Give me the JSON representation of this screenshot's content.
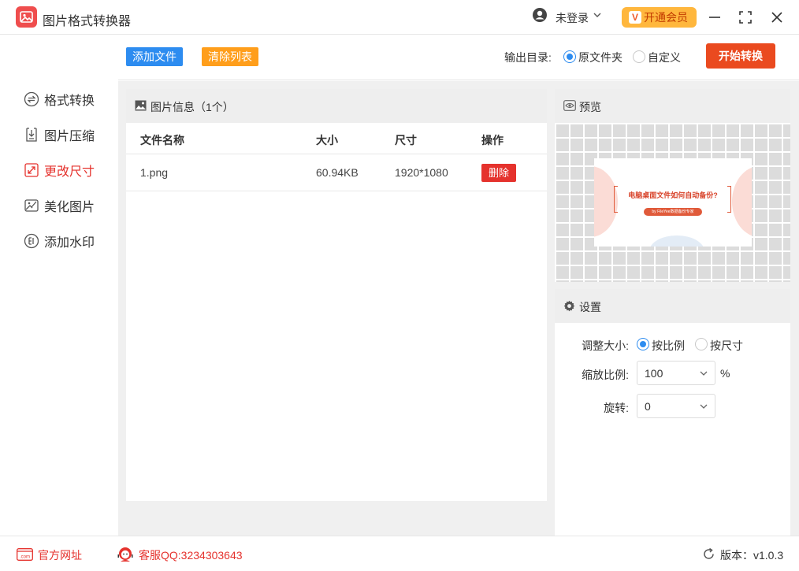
{
  "app": {
    "title": "图片格式转换器"
  },
  "user": {
    "name": "未登录",
    "vip_label": "开通会员",
    "vip_glyph": "V"
  },
  "sidebar": {
    "items": [
      {
        "label": "格式转换",
        "icon": "swap-circle-icon",
        "active": false
      },
      {
        "label": "图片压缩",
        "icon": "compress-icon",
        "active": false
      },
      {
        "label": "更改尺寸",
        "icon": "resize-icon",
        "active": true
      },
      {
        "label": "美化图片",
        "icon": "beautify-icon",
        "active": false
      },
      {
        "label": "添加水印",
        "icon": "watermark-icon",
        "active": false
      }
    ]
  },
  "toolbar": {
    "add_label": "添加文件",
    "clear_label": "清除列表",
    "output_label": "输出目录:",
    "output_options": [
      "原文件夹",
      "自定义"
    ],
    "output_selected": "原文件夹",
    "start_label": "开始转换"
  },
  "files": {
    "header": "图片信息（1个）",
    "columns": [
      "文件名称",
      "大小",
      "尺寸",
      "操作"
    ],
    "rows": [
      {
        "name": "1.png",
        "size": "60.94KB",
        "dims": "1920*1080",
        "action": "删除"
      }
    ]
  },
  "preview": {
    "header": "预览",
    "thumb_title": "电脑桌面文件如何自动备份?",
    "thumb_subtitle": "by FileYee数据备份专家"
  },
  "settings": {
    "header": "设置",
    "resize_label": "调整大小:",
    "resize_options": [
      "按比例",
      "按尺寸"
    ],
    "resize_selected": "按比例",
    "scale_label": "缩放比例:",
    "scale_value": "100",
    "scale_unit": "%",
    "rotate_label": "旋转:",
    "rotate_value": "0"
  },
  "footer": {
    "site_label": "官方网址",
    "site_icon_text": ".com",
    "qq_label": "客服QQ:3234303643",
    "version_label": "版本：v1.0.3"
  },
  "colors": {
    "accent_red": "#e5322d",
    "blue": "#2d8cf0",
    "orange": "#ff9e1b",
    "start_button": "#ea4a1f",
    "vip_gold": "#ffb73d"
  }
}
